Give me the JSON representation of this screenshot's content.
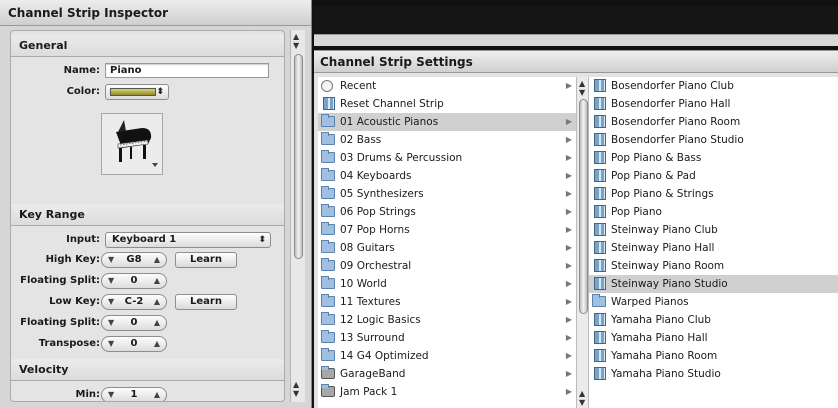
{
  "inspector": {
    "title": "Channel Strip Inspector",
    "general": {
      "heading": "General",
      "name_label": "Name:",
      "name_value": "Piano",
      "color_label": "Color:",
      "color_value": "#bdb757",
      "icon": "grand-piano-icon"
    },
    "key_range": {
      "heading": "Key Range",
      "input_label": "Input:",
      "input_value": "Keyboard 1",
      "high_key_label": "High Key:",
      "high_key_value": "G8",
      "learn_label": "Learn",
      "floating_split_label": "Floating Split:",
      "floating_split_1_value": "0",
      "low_key_label": "Low Key:",
      "low_key_value": "C-2",
      "floating_split_2_value": "0",
      "transpose_label": "Transpose:",
      "transpose_value": "0"
    },
    "velocity": {
      "heading": "Velocity",
      "min_label": "Min:",
      "min_value": "1"
    }
  },
  "settings": {
    "title": "Channel Strip Settings",
    "categories": [
      {
        "label": "Recent",
        "icon": "clock-icon",
        "submenu": true
      },
      {
        "label": "Reset Channel Strip",
        "icon": "channel-strip-icon",
        "submenu": false
      },
      {
        "label": "01 Acoustic Pianos",
        "icon": "folder-icon",
        "submenu": true,
        "selected": true
      },
      {
        "label": "02 Bass",
        "icon": "folder-icon",
        "submenu": true
      },
      {
        "label": "03 Drums & Percussion",
        "icon": "folder-icon",
        "submenu": true
      },
      {
        "label": "04 Keyboards",
        "icon": "folder-icon",
        "submenu": true
      },
      {
        "label": "05 Synthesizers",
        "icon": "folder-icon",
        "submenu": true
      },
      {
        "label": "06 Pop Strings",
        "icon": "folder-icon",
        "submenu": true
      },
      {
        "label": "07 Pop Horns",
        "icon": "folder-icon",
        "submenu": true
      },
      {
        "label": "08 Guitars",
        "icon": "folder-icon",
        "submenu": true
      },
      {
        "label": "09 Orchestral",
        "icon": "folder-icon",
        "submenu": true
      },
      {
        "label": "10 World",
        "icon": "folder-icon",
        "submenu": true
      },
      {
        "label": "11 Textures",
        "icon": "folder-icon",
        "submenu": true
      },
      {
        "label": "12 Logic Basics",
        "icon": "folder-icon",
        "submenu": true
      },
      {
        "label": "13 Surround",
        "icon": "folder-icon",
        "submenu": true
      },
      {
        "label": "14 G4 Optimized",
        "icon": "folder-icon",
        "submenu": true
      },
      {
        "label": "GarageBand",
        "icon": "garageband-folder-icon",
        "submenu": true
      },
      {
        "label": "Jam Pack 1",
        "icon": "jampack-folder-icon",
        "submenu": true
      }
    ],
    "presets": [
      {
        "label": "Bosendorfer Piano Club",
        "icon": "channel-strip-icon"
      },
      {
        "label": "Bosendorfer Piano Hall",
        "icon": "channel-strip-icon"
      },
      {
        "label": "Bosendorfer Piano Room",
        "icon": "channel-strip-icon"
      },
      {
        "label": "Bosendorfer Piano Studio",
        "icon": "channel-strip-icon"
      },
      {
        "label": "Pop Piano & Bass",
        "icon": "channel-strip-icon"
      },
      {
        "label": "Pop Piano & Pad",
        "icon": "channel-strip-icon"
      },
      {
        "label": "Pop Piano & Strings",
        "icon": "channel-strip-icon"
      },
      {
        "label": "Pop Piano",
        "icon": "channel-strip-icon"
      },
      {
        "label": "Steinway Piano Club",
        "icon": "channel-strip-icon"
      },
      {
        "label": "Steinway Piano Hall",
        "icon": "channel-strip-icon"
      },
      {
        "label": "Steinway Piano Room",
        "icon": "channel-strip-icon"
      },
      {
        "label": "Steinway Piano Studio",
        "icon": "channel-strip-icon",
        "selected": true
      },
      {
        "label": "Warped Pianos",
        "icon": "folder-icon"
      },
      {
        "label": "Yamaha Piano Club",
        "icon": "channel-strip-icon"
      },
      {
        "label": "Yamaha Piano Hall",
        "icon": "channel-strip-icon"
      },
      {
        "label": "Yamaha Piano Room",
        "icon": "channel-strip-icon"
      },
      {
        "label": "Yamaha Piano Studio",
        "icon": "channel-strip-icon"
      }
    ]
  }
}
